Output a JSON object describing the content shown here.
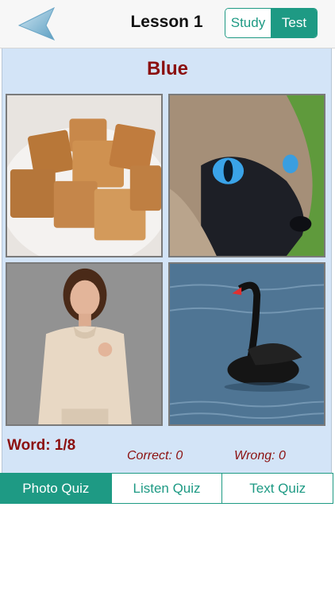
{
  "header": {
    "title": "Lesson 1",
    "modes": [
      {
        "label": "Study"
      },
      {
        "label": "Test"
      }
    ],
    "selected_mode": "Test"
  },
  "quiz": {
    "word": "Blue",
    "photos": [
      {
        "description_icon": "caramel-candies-image"
      },
      {
        "description_icon": "siamese-cat-blue-eyes-image"
      },
      {
        "description_icon": "woman-portrait-image"
      },
      {
        "description_icon": "black-swan-image"
      }
    ],
    "counter": "Word: 1/8",
    "correct": "Correct: 0",
    "wrong": "Wrong: 0"
  },
  "tabs": [
    {
      "label": "Photo Quiz"
    },
    {
      "label": "Listen Quiz"
    },
    {
      "label": "Text Quiz"
    }
  ],
  "active_tab": "Photo Quiz",
  "colors": {
    "accent": "#1e9a84",
    "word_color": "#8b1010",
    "panel_bg": "#d3e4f7"
  }
}
